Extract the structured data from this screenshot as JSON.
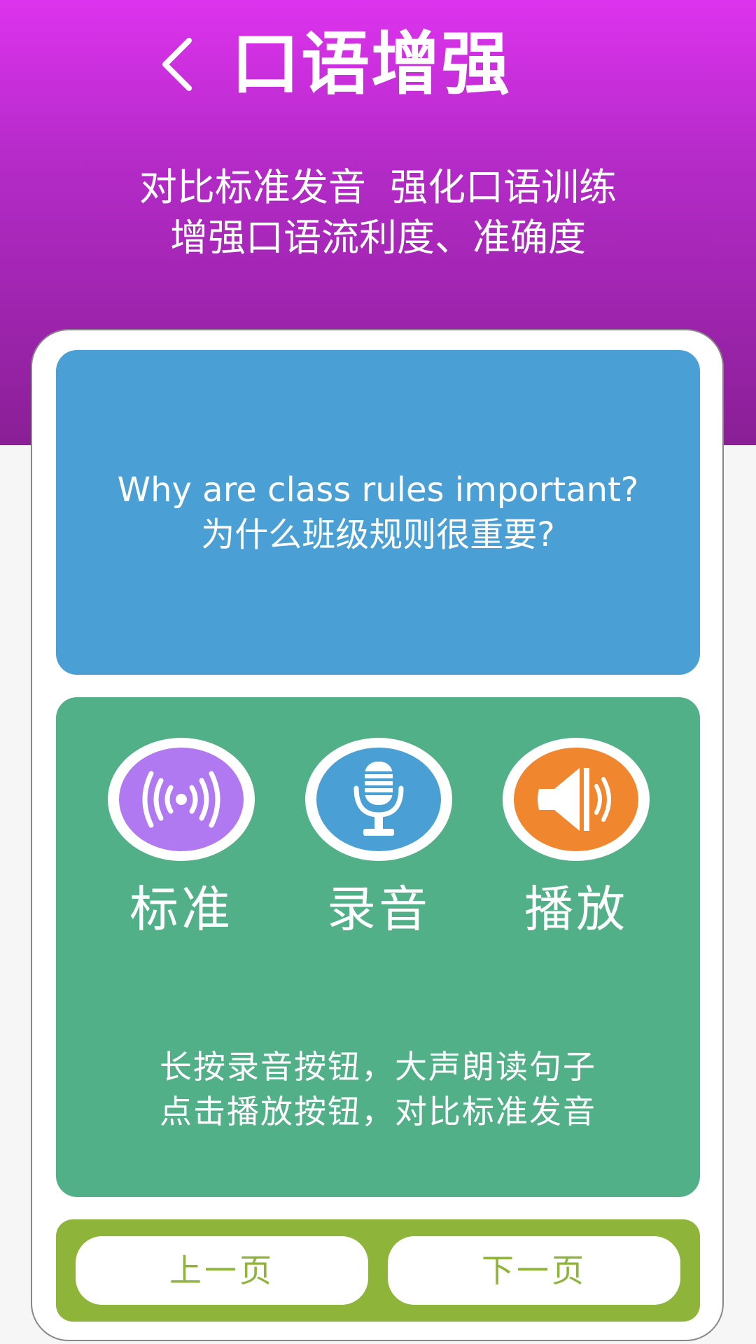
{
  "header": {
    "title": "口语增强",
    "subtitle_line1": "对比标准发音  强化口语训练",
    "subtitle_line2": "增强口语流利度、准确度"
  },
  "question": {
    "english": "Why are class rules important?",
    "chinese": "为什么班级规则很重要?"
  },
  "controls": [
    {
      "label": "标准",
      "icon": "broadcast-icon",
      "color": "#b079f2"
    },
    {
      "label": "录音",
      "icon": "microphone-icon",
      "color": "#4aa0d5"
    },
    {
      "label": "播放",
      "icon": "speaker-icon",
      "color": "#f0862e"
    }
  ],
  "hint": {
    "line1": "长按录音按钮，大声朗读句子",
    "line2": "点击播放按钮，对比标准发音"
  },
  "nav": {
    "prev_label": "上一页",
    "next_label": "下一页"
  },
  "colors": {
    "header_top": "#dd33ee",
    "header_bottom": "#8a1f96",
    "question_bg": "#4aa0d5",
    "practice_bg": "#52b089",
    "nav_bg": "#8fb43a"
  }
}
